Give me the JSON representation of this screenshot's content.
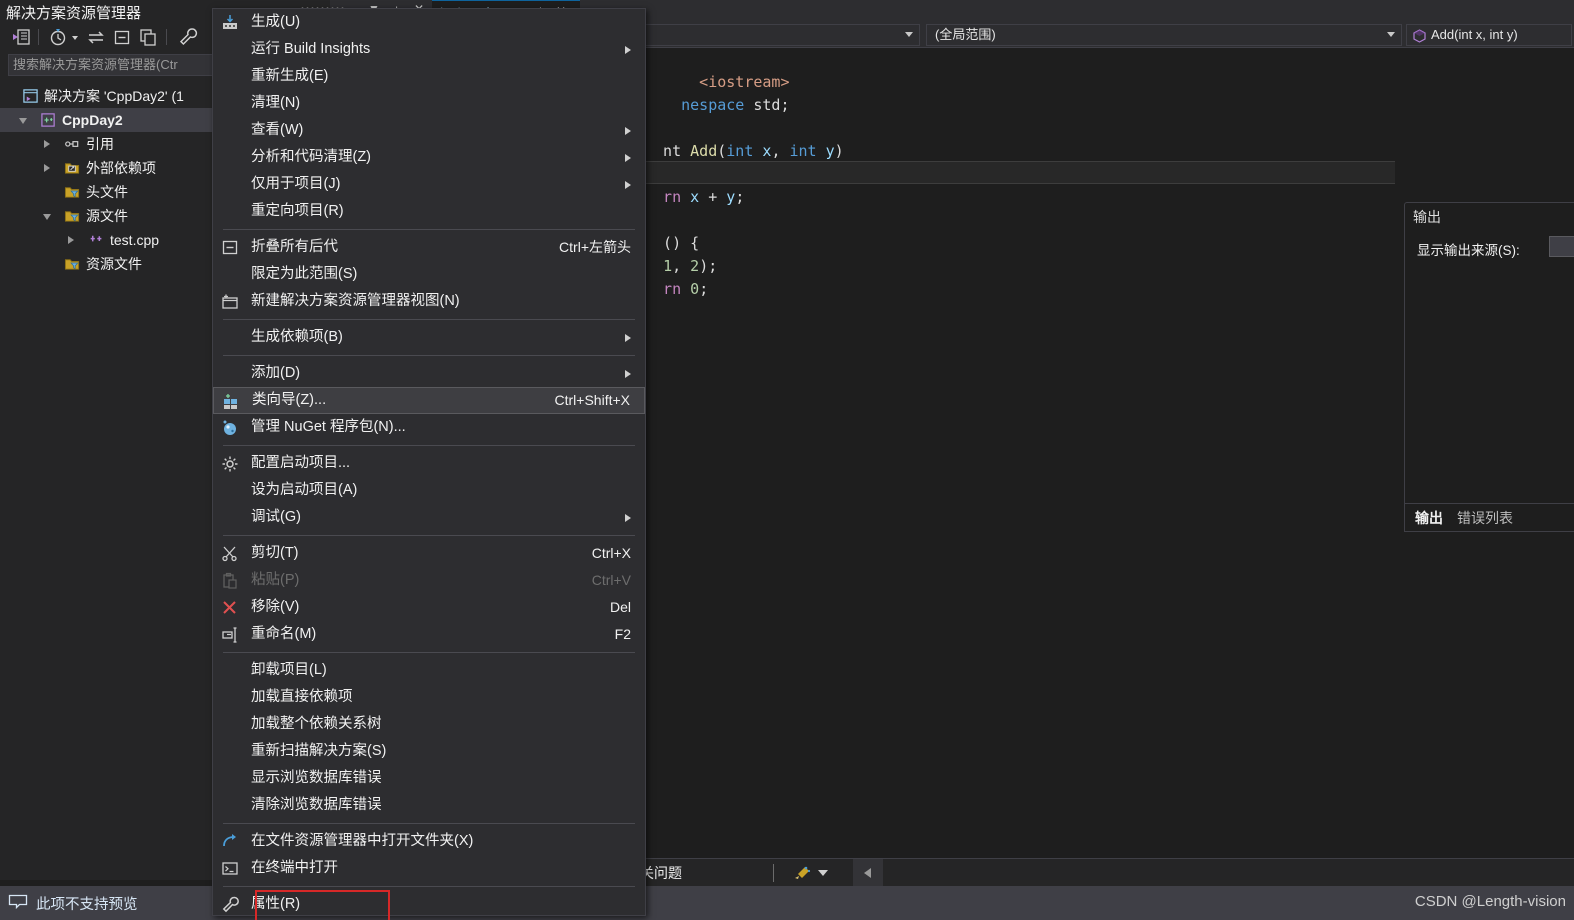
{
  "app": {
    "tabstrip": {
      "solution_explorer_tab": "解决方案资源管理器",
      "file_tab": "test.cpp*"
    }
  },
  "solution_explorer": {
    "toolbar_icons": [
      "home-vs-icon",
      "pending-changes-clock-icon",
      "dropdown-caret-icon",
      "sync-with-active-document-icon",
      "collapse-all-icon",
      "show-all-files-icon",
      "properties-wrench-icon"
    ],
    "search_placeholder": "搜索解决方案资源管理器(Ctr",
    "tree": [
      {
        "label": "解决方案 'CppDay2' (1",
        "icon": "solution-icon",
        "indent": 22,
        "arrow": "none",
        "selected": false
      },
      {
        "label": "CppDay2",
        "icon": "cpp-project-icon",
        "indent": 40,
        "arrow": "open",
        "selected": true
      },
      {
        "label": "引用",
        "icon": "references-icon",
        "indent": 64,
        "arrow": "closed",
        "selected": false
      },
      {
        "label": "外部依赖项",
        "icon": "external-deps-folder-icon",
        "indent": 64,
        "arrow": "closed",
        "selected": false
      },
      {
        "label": "头文件",
        "icon": "filter-folder-icon",
        "indent": 64,
        "arrow": "none",
        "selected": false
      },
      {
        "label": "源文件",
        "icon": "filter-folder-icon",
        "indent": 64,
        "arrow": "open",
        "selected": false
      },
      {
        "label": "test.cpp",
        "icon": "cpp-file-icon",
        "indent": 88,
        "arrow": "closed",
        "selected": false
      },
      {
        "label": "资源文件",
        "icon": "filter-folder-icon",
        "indent": 64,
        "arrow": "none",
        "selected": false
      }
    ]
  },
  "editor": {
    "combo_project": "",
    "combo_scope": "(全局范围)",
    "combo_member": "Add(int x, int y)",
    "code_lines": [
      "      <iostream>",
      "    nespace std;",
      "",
      "  nt Add(int x, int y)",
      "",
      "  rn x + y;",
      "",
      "  () {",
      "   1, 2);",
      "  rn 0;"
    ],
    "lower_strip": {
      "related_issues": "关问题",
      "broom_icon": "code-cleanup-broom-icon",
      "collapse_icon": "collapse-left-arrow-icon"
    }
  },
  "output_panel": {
    "title": "输出",
    "source_label": "显示输出来源(S):",
    "source_value": "",
    "tabs": [
      {
        "label": "输出",
        "active": true
      },
      {
        "label": "错误列表",
        "active": false
      }
    ]
  },
  "status_bar": {
    "icon": "preview-window-icon",
    "text": "此项不支持预览",
    "watermark": "CSDN @Length-vision"
  },
  "context_menu": {
    "items": [
      {
        "type": "item",
        "label": "生成(U)",
        "shortcut": "",
        "submenu": false,
        "icon": "build-icon",
        "disabled": false,
        "hover": false
      },
      {
        "type": "item",
        "label": "运行 Build Insights",
        "shortcut": "",
        "submenu": true,
        "icon": "",
        "disabled": false,
        "hover": false
      },
      {
        "type": "item",
        "label": "重新生成(E)",
        "shortcut": "",
        "submenu": false,
        "icon": "",
        "disabled": false,
        "hover": false
      },
      {
        "type": "item",
        "label": "清理(N)",
        "shortcut": "",
        "submenu": false,
        "icon": "",
        "disabled": false,
        "hover": false
      },
      {
        "type": "item",
        "label": "查看(W)",
        "shortcut": "",
        "submenu": true,
        "icon": "",
        "disabled": false,
        "hover": false
      },
      {
        "type": "item",
        "label": "分析和代码清理(Z)",
        "shortcut": "",
        "submenu": true,
        "icon": "",
        "disabled": false,
        "hover": false
      },
      {
        "type": "item",
        "label": "仅用于项目(J)",
        "shortcut": "",
        "submenu": true,
        "icon": "",
        "disabled": false,
        "hover": false
      },
      {
        "type": "item",
        "label": "重定向项目(R)",
        "shortcut": "",
        "submenu": false,
        "icon": "",
        "disabled": false,
        "hover": false
      },
      {
        "type": "separator"
      },
      {
        "type": "item",
        "label": "折叠所有后代",
        "shortcut": "Ctrl+左箭头",
        "submenu": false,
        "icon": "collapse-descendants-icon",
        "disabled": false,
        "hover": false
      },
      {
        "type": "item",
        "label": "限定为此范围(S)",
        "shortcut": "",
        "submenu": false,
        "icon": "",
        "disabled": false,
        "hover": false
      },
      {
        "type": "item",
        "label": "新建解决方案资源管理器视图(N)",
        "shortcut": "",
        "submenu": false,
        "icon": "new-solution-view-icon",
        "disabled": false,
        "hover": false
      },
      {
        "type": "separator"
      },
      {
        "type": "item",
        "label": "生成依赖项(B)",
        "shortcut": "",
        "submenu": true,
        "icon": "",
        "disabled": false,
        "hover": false
      },
      {
        "type": "separator"
      },
      {
        "type": "item",
        "label": "添加(D)",
        "shortcut": "",
        "submenu": true,
        "icon": "",
        "disabled": false,
        "hover": false
      },
      {
        "type": "item",
        "label": "类向导(Z)...",
        "shortcut": "Ctrl+Shift+X",
        "submenu": false,
        "icon": "class-wizard-icon",
        "disabled": false,
        "hover": true
      },
      {
        "type": "item",
        "label": "管理 NuGet 程序包(N)...",
        "shortcut": "",
        "submenu": false,
        "icon": "nuget-icon",
        "disabled": false,
        "hover": false
      },
      {
        "type": "separator"
      },
      {
        "type": "item",
        "label": "配置启动项目...",
        "shortcut": "",
        "submenu": false,
        "icon": "gear-icon",
        "disabled": false,
        "hover": false
      },
      {
        "type": "item",
        "label": "设为启动项目(A)",
        "shortcut": "",
        "submenu": false,
        "icon": "",
        "disabled": false,
        "hover": false
      },
      {
        "type": "item",
        "label": "调试(G)",
        "shortcut": "",
        "submenu": true,
        "icon": "",
        "disabled": false,
        "hover": false
      },
      {
        "type": "separator"
      },
      {
        "type": "item",
        "label": "剪切(T)",
        "shortcut": "Ctrl+X",
        "submenu": false,
        "icon": "scissors-cut-icon",
        "disabled": false,
        "hover": false
      },
      {
        "type": "item",
        "label": "粘贴(P)",
        "shortcut": "Ctrl+V",
        "submenu": false,
        "icon": "clipboard-paste-icon",
        "disabled": true,
        "hover": false
      },
      {
        "type": "item",
        "label": "移除(V)",
        "shortcut": "Del",
        "submenu": false,
        "icon": "remove-x-icon",
        "disabled": false,
        "hover": false
      },
      {
        "type": "item",
        "label": "重命名(M)",
        "shortcut": "F2",
        "submenu": false,
        "icon": "rename-icon",
        "disabled": false,
        "hover": false
      },
      {
        "type": "separator"
      },
      {
        "type": "item",
        "label": "卸载项目(L)",
        "shortcut": "",
        "submenu": false,
        "icon": "",
        "disabled": false,
        "hover": false
      },
      {
        "type": "item",
        "label": "加载直接依赖项",
        "shortcut": "",
        "submenu": false,
        "icon": "",
        "disabled": false,
        "hover": false
      },
      {
        "type": "item",
        "label": "加载整个依赖关系树",
        "shortcut": "",
        "submenu": false,
        "icon": "",
        "disabled": false,
        "hover": false
      },
      {
        "type": "item",
        "label": "重新扫描解决方案(S)",
        "shortcut": "",
        "submenu": false,
        "icon": "",
        "disabled": false,
        "hover": false
      },
      {
        "type": "item",
        "label": "显示浏览数据库错误",
        "shortcut": "",
        "submenu": false,
        "icon": "",
        "disabled": false,
        "hover": false
      },
      {
        "type": "item",
        "label": "清除浏览数据库错误",
        "shortcut": "",
        "submenu": false,
        "icon": "",
        "disabled": false,
        "hover": false
      },
      {
        "type": "separator"
      },
      {
        "type": "item",
        "label": "在文件资源管理器中打开文件夹(X)",
        "shortcut": "",
        "submenu": false,
        "icon": "open-folder-arrow-icon",
        "disabled": false,
        "hover": false
      },
      {
        "type": "item",
        "label": "在终端中打开",
        "shortcut": "",
        "submenu": false,
        "icon": "terminal-icon",
        "disabled": false,
        "hover": false
      },
      {
        "type": "separator"
      },
      {
        "type": "item",
        "label": "属性(R)",
        "shortcut": "",
        "submenu": false,
        "icon": "properties-wrench-icon",
        "disabled": false,
        "hover": false,
        "highlight_box": true
      }
    ]
  },
  "colors": {
    "menu_bg": "#2d2d30",
    "panel_bg": "#252526",
    "editor_bg": "#1e1e1e",
    "hover_bg": "#3e3e42",
    "accent_red": "#d72828",
    "status_bg": "#3f3f46"
  }
}
